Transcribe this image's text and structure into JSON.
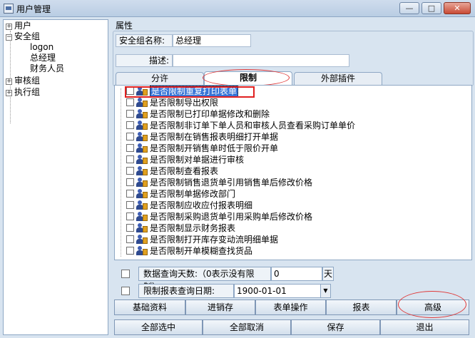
{
  "window": {
    "title": "用户管理",
    "controls": [
      "—",
      "□",
      "✕"
    ]
  },
  "tree": {
    "items": [
      {
        "label": "用户",
        "expander": "+"
      },
      {
        "label": "安全组",
        "expander": "−"
      },
      {
        "label": "logon"
      },
      {
        "label": "总经理"
      },
      {
        "label": "财务人员"
      },
      {
        "label": "审核组",
        "expander": "+"
      },
      {
        "label": "执行组",
        "expander": "+"
      }
    ]
  },
  "attributes": {
    "section_label": "属性",
    "group_name_label": "安全组名称:",
    "group_name_value": "总经理",
    "desc_label": "描述:",
    "desc_value": ""
  },
  "tabs": [
    {
      "label": "分许"
    },
    {
      "label": "限制",
      "active": true
    },
    {
      "label": "外部插件"
    }
  ],
  "permissions": [
    {
      "label": "是否限制重复打印表单",
      "checked": false,
      "selected": true
    },
    {
      "label": "是否限制导出权限",
      "checked": false
    },
    {
      "label": "是否限制已打印单据修改和删除",
      "checked": false
    },
    {
      "label": "是否限制非订单下单人员和审核人员查看采购订单单价",
      "checked": false
    },
    {
      "label": "是否限制在销售报表明细打开单据",
      "checked": false
    },
    {
      "label": "是否限制开销售单时低于限价开单",
      "checked": false
    },
    {
      "label": "是否限制对单据进行审核",
      "checked": false
    },
    {
      "label": "是否限制查看报表",
      "checked": false
    },
    {
      "label": "是否限制销售退货单引用销售单后修改价格",
      "checked": false
    },
    {
      "label": "是否限制单据修改部门",
      "checked": false
    },
    {
      "label": "是否限制应收应付报表明细",
      "checked": false
    },
    {
      "label": "是否限制采购退货单引用采购单后修改价格",
      "checked": false
    },
    {
      "label": "是否限制显示财务报表",
      "checked": false
    },
    {
      "label": "是否限制打开库存变动流明细单据",
      "checked": false
    },
    {
      "label": "是否限制开单模糊查找货品",
      "checked": false
    }
  ],
  "options": {
    "query_days_label": "数据查询天数:（0表示没有限制）",
    "query_days_value": "0",
    "query_days_unit": "天",
    "report_date_label": "限制报表查询日期:",
    "report_date_value": "1900-01-01"
  },
  "category_buttons": [
    "基础资料",
    "进销存",
    "表单操作",
    "报表",
    "高级"
  ],
  "action_buttons": [
    "全部选中",
    "全部取消",
    "保存",
    "退出"
  ]
}
